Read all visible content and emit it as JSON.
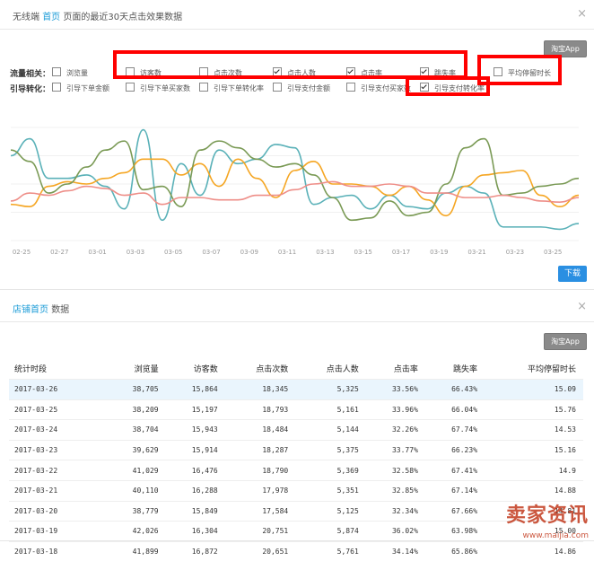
{
  "panel1": {
    "header_prefix": "无线端",
    "header_link": "首页",
    "header_suffix": "页面的最近30天点击效果数据",
    "app_button": "淘宝App",
    "row1_label": "流量相关：",
    "row2_label": "引导转化：",
    "row1": [
      {
        "label": "浏览量",
        "checked": false
      },
      {
        "label": "访客数",
        "checked": false
      },
      {
        "label": "点击次数",
        "checked": false
      },
      {
        "label": "点击人数",
        "checked": true
      },
      {
        "label": "点击率",
        "checked": true
      },
      {
        "label": "跳失率",
        "checked": true
      },
      {
        "label": "平均停留时长",
        "checked": false
      }
    ],
    "row2": [
      {
        "label": "引导下单金额",
        "checked": false
      },
      {
        "label": "引导下单买家数",
        "checked": false
      },
      {
        "label": "引导下单转化率",
        "checked": false
      },
      {
        "label": "引导支付金额",
        "checked": false
      },
      {
        "label": "引导支付买家数",
        "checked": false
      },
      {
        "label": "引导支付转化率",
        "checked": true
      }
    ],
    "download_button": "下载",
    "close": "×"
  },
  "chart_data": {
    "type": "line",
    "x_ticks": [
      "02-25",
      "02-27",
      "03-01",
      "03-03",
      "03-05",
      "03-07",
      "03-09",
      "03-11",
      "03-13",
      "03-15",
      "03-17",
      "03-19",
      "03-21",
      "03-23",
      "03-25"
    ],
    "ylim": [
      0,
      100
    ],
    "series": [
      {
        "color": "#5ab1b8",
        "values": [
          75,
          90,
          55,
          55,
          58,
          48,
          28,
          98,
          18,
          68,
          40,
          80,
          68,
          72,
          85,
          82,
          32,
          38,
          40,
          28,
          40,
          30,
          28,
          42,
          48,
          42,
          12,
          12,
          12,
          10,
          15
        ]
      },
      {
        "color": "#f5a623",
        "values": [
          32,
          30,
          48,
          52,
          50,
          55,
          60,
          72,
          72,
          58,
          68,
          48,
          72,
          55,
          38,
          62,
          70,
          50,
          50,
          48,
          40,
          48,
          36,
          22,
          48,
          58,
          60,
          62,
          40,
          30,
          40
        ]
      },
      {
        "color": "#7a9a55",
        "values": [
          80,
          70,
          42,
          50,
          65,
          80,
          88,
          45,
          48,
          30,
          80,
          88,
          82,
          72,
          65,
          68,
          58,
          38,
          18,
          20,
          35,
          22,
          25,
          50,
          82,
          90,
          40,
          42,
          48,
          50,
          55
        ]
      },
      {
        "color": "#ee8e88",
        "values": [
          35,
          42,
          40,
          44,
          48,
          46,
          40,
          42,
          32,
          38,
          38,
          36,
          36,
          40,
          40,
          45,
          50,
          52,
          48,
          48,
          50,
          48,
          42,
          42,
          38,
          38,
          40,
          38,
          35,
          34,
          38
        ]
      }
    ]
  },
  "panel2": {
    "header_link": "店铺首页",
    "header_suffix": "数据",
    "app_button": "淘宝App",
    "close": "×",
    "columns": [
      "统计时段",
      "浏览量",
      "访客数",
      "点击次数",
      "点击人数",
      "点击率",
      "跳失率",
      "平均停留时长"
    ],
    "rows": [
      [
        "2017-03-26",
        "38,705",
        "15,864",
        "18,345",
        "5,325",
        "33.56%",
        "66.43%",
        "15.09"
      ],
      [
        "2017-03-25",
        "38,209",
        "15,197",
        "18,793",
        "5,161",
        "33.96%",
        "66.04%",
        "15.76"
      ],
      [
        "2017-03-24",
        "38,704",
        "15,943",
        "18,484",
        "5,144",
        "32.26%",
        "67.74%",
        "14.53"
      ],
      [
        "2017-03-23",
        "39,629",
        "15,914",
        "18,287",
        "5,375",
        "33.77%",
        "66.23%",
        "15.16"
      ],
      [
        "2017-03-22",
        "41,029",
        "16,476",
        "18,790",
        "5,369",
        "32.58%",
        "67.41%",
        "14.9"
      ],
      [
        "2017-03-21",
        "40,110",
        "16,288",
        "17,978",
        "5,351",
        "32.85%",
        "67.14%",
        "14.88"
      ],
      [
        "2017-03-20",
        "38,779",
        "15,849",
        "17,584",
        "5,125",
        "32.34%",
        "67.66%",
        "14.81"
      ],
      [
        "2017-03-19",
        "42,026",
        "16,304",
        "20,751",
        "5,874",
        "36.02%",
        "63.98%",
        "15.00"
      ],
      [
        "2017-03-18",
        "41,899",
        "16,872",
        "20,651",
        "5,761",
        "34.14%",
        "65.86%",
        "14.86"
      ]
    ]
  },
  "watermark": {
    "text": "卖家资讯",
    "url": "www.maijia.com"
  }
}
